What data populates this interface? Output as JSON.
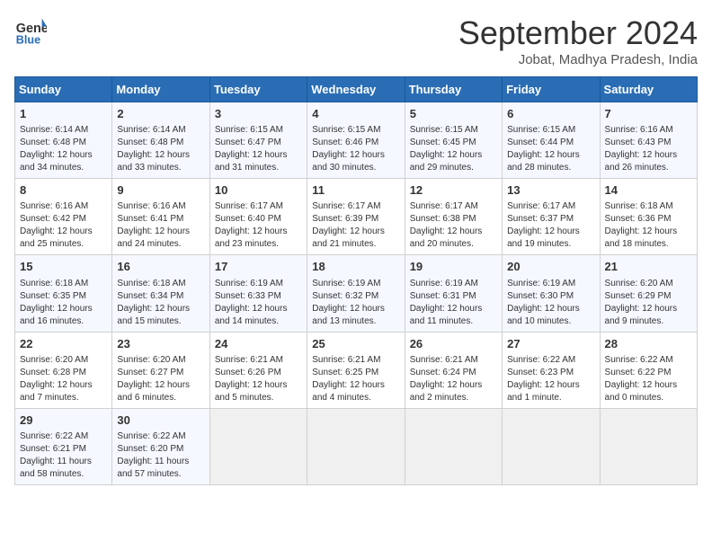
{
  "header": {
    "logo_line1": "General",
    "logo_line2": "Blue",
    "month": "September 2024",
    "location": "Jobat, Madhya Pradesh, India"
  },
  "days_of_week": [
    "Sunday",
    "Monday",
    "Tuesday",
    "Wednesday",
    "Thursday",
    "Friday",
    "Saturday"
  ],
  "weeks": [
    [
      {
        "day": "1",
        "lines": [
          "Sunrise: 6:14 AM",
          "Sunset: 6:48 PM",
          "Daylight: 12 hours",
          "and 34 minutes."
        ]
      },
      {
        "day": "2",
        "lines": [
          "Sunrise: 6:14 AM",
          "Sunset: 6:48 PM",
          "Daylight: 12 hours",
          "and 33 minutes."
        ]
      },
      {
        "day": "3",
        "lines": [
          "Sunrise: 6:15 AM",
          "Sunset: 6:47 PM",
          "Daylight: 12 hours",
          "and 31 minutes."
        ]
      },
      {
        "day": "4",
        "lines": [
          "Sunrise: 6:15 AM",
          "Sunset: 6:46 PM",
          "Daylight: 12 hours",
          "and 30 minutes."
        ]
      },
      {
        "day": "5",
        "lines": [
          "Sunrise: 6:15 AM",
          "Sunset: 6:45 PM",
          "Daylight: 12 hours",
          "and 29 minutes."
        ]
      },
      {
        "day": "6",
        "lines": [
          "Sunrise: 6:15 AM",
          "Sunset: 6:44 PM",
          "Daylight: 12 hours",
          "and 28 minutes."
        ]
      },
      {
        "day": "7",
        "lines": [
          "Sunrise: 6:16 AM",
          "Sunset: 6:43 PM",
          "Daylight: 12 hours",
          "and 26 minutes."
        ]
      }
    ],
    [
      {
        "day": "8",
        "lines": [
          "Sunrise: 6:16 AM",
          "Sunset: 6:42 PM",
          "Daylight: 12 hours",
          "and 25 minutes."
        ]
      },
      {
        "day": "9",
        "lines": [
          "Sunrise: 6:16 AM",
          "Sunset: 6:41 PM",
          "Daylight: 12 hours",
          "and 24 minutes."
        ]
      },
      {
        "day": "10",
        "lines": [
          "Sunrise: 6:17 AM",
          "Sunset: 6:40 PM",
          "Daylight: 12 hours",
          "and 23 minutes."
        ]
      },
      {
        "day": "11",
        "lines": [
          "Sunrise: 6:17 AM",
          "Sunset: 6:39 PM",
          "Daylight: 12 hours",
          "and 21 minutes."
        ]
      },
      {
        "day": "12",
        "lines": [
          "Sunrise: 6:17 AM",
          "Sunset: 6:38 PM",
          "Daylight: 12 hours",
          "and 20 minutes."
        ]
      },
      {
        "day": "13",
        "lines": [
          "Sunrise: 6:17 AM",
          "Sunset: 6:37 PM",
          "Daylight: 12 hours",
          "and 19 minutes."
        ]
      },
      {
        "day": "14",
        "lines": [
          "Sunrise: 6:18 AM",
          "Sunset: 6:36 PM",
          "Daylight: 12 hours",
          "and 18 minutes."
        ]
      }
    ],
    [
      {
        "day": "15",
        "lines": [
          "Sunrise: 6:18 AM",
          "Sunset: 6:35 PM",
          "Daylight: 12 hours",
          "and 16 minutes."
        ]
      },
      {
        "day": "16",
        "lines": [
          "Sunrise: 6:18 AM",
          "Sunset: 6:34 PM",
          "Daylight: 12 hours",
          "and 15 minutes."
        ]
      },
      {
        "day": "17",
        "lines": [
          "Sunrise: 6:19 AM",
          "Sunset: 6:33 PM",
          "Daylight: 12 hours",
          "and 14 minutes."
        ]
      },
      {
        "day": "18",
        "lines": [
          "Sunrise: 6:19 AM",
          "Sunset: 6:32 PM",
          "Daylight: 12 hours",
          "and 13 minutes."
        ]
      },
      {
        "day": "19",
        "lines": [
          "Sunrise: 6:19 AM",
          "Sunset: 6:31 PM",
          "Daylight: 12 hours",
          "and 11 minutes."
        ]
      },
      {
        "day": "20",
        "lines": [
          "Sunrise: 6:19 AM",
          "Sunset: 6:30 PM",
          "Daylight: 12 hours",
          "and 10 minutes."
        ]
      },
      {
        "day": "21",
        "lines": [
          "Sunrise: 6:20 AM",
          "Sunset: 6:29 PM",
          "Daylight: 12 hours",
          "and 9 minutes."
        ]
      }
    ],
    [
      {
        "day": "22",
        "lines": [
          "Sunrise: 6:20 AM",
          "Sunset: 6:28 PM",
          "Daylight: 12 hours",
          "and 7 minutes."
        ]
      },
      {
        "day": "23",
        "lines": [
          "Sunrise: 6:20 AM",
          "Sunset: 6:27 PM",
          "Daylight: 12 hours",
          "and 6 minutes."
        ]
      },
      {
        "day": "24",
        "lines": [
          "Sunrise: 6:21 AM",
          "Sunset: 6:26 PM",
          "Daylight: 12 hours",
          "and 5 minutes."
        ]
      },
      {
        "day": "25",
        "lines": [
          "Sunrise: 6:21 AM",
          "Sunset: 6:25 PM",
          "Daylight: 12 hours",
          "and 4 minutes."
        ]
      },
      {
        "day": "26",
        "lines": [
          "Sunrise: 6:21 AM",
          "Sunset: 6:24 PM",
          "Daylight: 12 hours",
          "and 2 minutes."
        ]
      },
      {
        "day": "27",
        "lines": [
          "Sunrise: 6:22 AM",
          "Sunset: 6:23 PM",
          "Daylight: 12 hours",
          "and 1 minute."
        ]
      },
      {
        "day": "28",
        "lines": [
          "Sunrise: 6:22 AM",
          "Sunset: 6:22 PM",
          "Daylight: 12 hours",
          "and 0 minutes."
        ]
      }
    ],
    [
      {
        "day": "29",
        "lines": [
          "Sunrise: 6:22 AM",
          "Sunset: 6:21 PM",
          "Daylight: 11 hours",
          "and 58 minutes."
        ]
      },
      {
        "day": "30",
        "lines": [
          "Sunrise: 6:22 AM",
          "Sunset: 6:20 PM",
          "Daylight: 11 hours",
          "and 57 minutes."
        ]
      },
      {
        "day": "",
        "lines": []
      },
      {
        "day": "",
        "lines": []
      },
      {
        "day": "",
        "lines": []
      },
      {
        "day": "",
        "lines": []
      },
      {
        "day": "",
        "lines": []
      }
    ]
  ]
}
